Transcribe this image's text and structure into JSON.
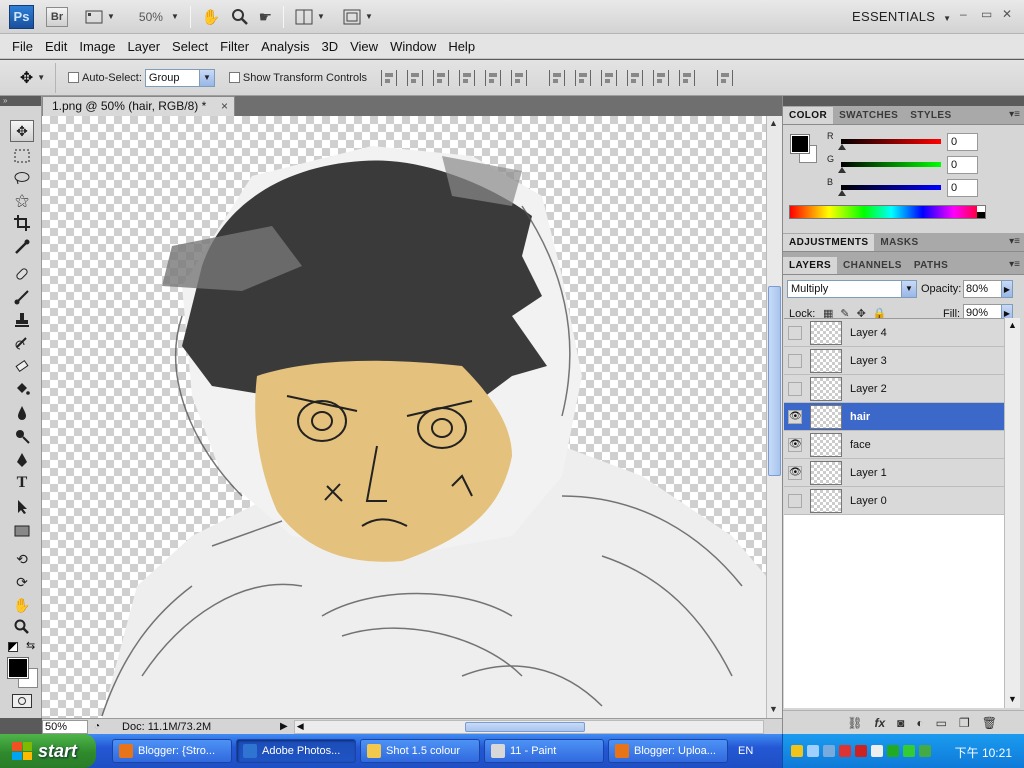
{
  "appbar": {
    "ps_logo": "Ps",
    "br_logo": "Br",
    "zoom": "50%",
    "workspace": "ESSENTIALS",
    "window_controls": {
      "minimize": "–",
      "restore": "▭",
      "close": "✕"
    }
  },
  "menu": [
    "File",
    "Edit",
    "Image",
    "Layer",
    "Select",
    "Filter",
    "Analysis",
    "3D",
    "View",
    "Window",
    "Help"
  ],
  "options": {
    "auto_select_label": "Auto-Select:",
    "auto_select_value": "Group",
    "show_transform_label": "Show Transform Controls"
  },
  "document": {
    "tab_title": "1.png @ 50% (hair, RGB/8) *",
    "tab_close": "×",
    "status_zoom": "50%",
    "doc_info": "Doc: 11.1M/73.2M"
  },
  "panels": {
    "color_tabs": [
      "COLOR",
      "SWATCHES",
      "STYLES"
    ],
    "color": {
      "r": "0",
      "g": "0",
      "b": "0",
      "r_label": "R",
      "g_label": "G",
      "b_label": "B"
    },
    "adjust_tabs": [
      "ADJUSTMENTS",
      "MASKS"
    ],
    "layer_tabs": [
      "LAYERS",
      "CHANNELS",
      "PATHS"
    ],
    "blend_mode": "Multiply",
    "opacity_label": "Opacity:",
    "opacity": "80%",
    "lock_label": "Lock:",
    "fill_label": "Fill:",
    "fill": "90%",
    "layers": [
      {
        "name": "Layer 4",
        "visible": false,
        "selected": false
      },
      {
        "name": "Layer 3",
        "visible": false,
        "selected": false
      },
      {
        "name": "Layer 2",
        "visible": false,
        "selected": false
      },
      {
        "name": "hair",
        "visible": true,
        "selected": true
      },
      {
        "name": "face",
        "visible": true,
        "selected": false
      },
      {
        "name": "Layer 1",
        "visible": true,
        "selected": false
      },
      {
        "name": "Layer 0",
        "visible": false,
        "selected": false
      }
    ]
  },
  "taskbar": {
    "start": "start",
    "tasks": [
      {
        "label": "Blogger: {Stro...",
        "icon_color": "#e8741a",
        "active": false
      },
      {
        "label": "Adobe Photos...",
        "icon_color": "#2f74d0",
        "active": true
      },
      {
        "label": "Shot 1.5 colour",
        "icon_color": "#f2c94c",
        "active": false
      },
      {
        "label": "11 - Paint",
        "icon_color": "#d8d8d8",
        "active": false
      },
      {
        "label": "Blogger: Uploa...",
        "icon_color": "#e8741a",
        "active": false
      }
    ],
    "lang": "EN",
    "clock": "下午 10:21"
  },
  "colors": {
    "accent": "#3b68c9",
    "skin": "#e4c17c",
    "hair": "#333333"
  }
}
